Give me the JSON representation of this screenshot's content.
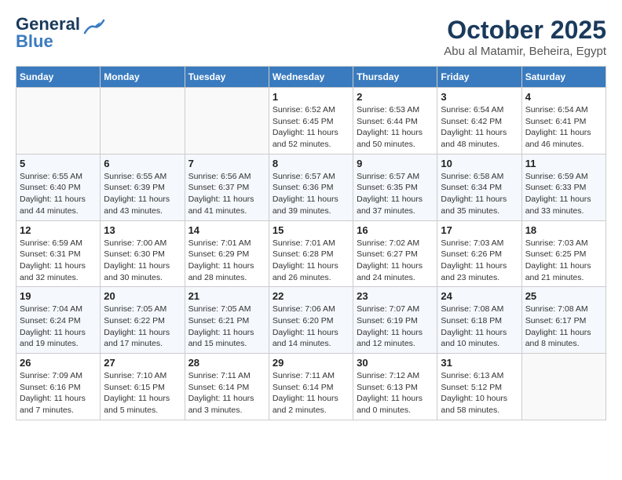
{
  "header": {
    "logo_line1": "General",
    "logo_line2": "Blue",
    "month": "October 2025",
    "location": "Abu al Matamir, Beheira, Egypt"
  },
  "weekdays": [
    "Sunday",
    "Monday",
    "Tuesday",
    "Wednesday",
    "Thursday",
    "Friday",
    "Saturday"
  ],
  "weeks": [
    [
      {
        "day": "",
        "info": ""
      },
      {
        "day": "",
        "info": ""
      },
      {
        "day": "",
        "info": ""
      },
      {
        "day": "1",
        "info": "Sunrise: 6:52 AM\nSunset: 6:45 PM\nDaylight: 11 hours\nand 52 minutes."
      },
      {
        "day": "2",
        "info": "Sunrise: 6:53 AM\nSunset: 6:44 PM\nDaylight: 11 hours\nand 50 minutes."
      },
      {
        "day": "3",
        "info": "Sunrise: 6:54 AM\nSunset: 6:42 PM\nDaylight: 11 hours\nand 48 minutes."
      },
      {
        "day": "4",
        "info": "Sunrise: 6:54 AM\nSunset: 6:41 PM\nDaylight: 11 hours\nand 46 minutes."
      }
    ],
    [
      {
        "day": "5",
        "info": "Sunrise: 6:55 AM\nSunset: 6:40 PM\nDaylight: 11 hours\nand 44 minutes."
      },
      {
        "day": "6",
        "info": "Sunrise: 6:55 AM\nSunset: 6:39 PM\nDaylight: 11 hours\nand 43 minutes."
      },
      {
        "day": "7",
        "info": "Sunrise: 6:56 AM\nSunset: 6:37 PM\nDaylight: 11 hours\nand 41 minutes."
      },
      {
        "day": "8",
        "info": "Sunrise: 6:57 AM\nSunset: 6:36 PM\nDaylight: 11 hours\nand 39 minutes."
      },
      {
        "day": "9",
        "info": "Sunrise: 6:57 AM\nSunset: 6:35 PM\nDaylight: 11 hours\nand 37 minutes."
      },
      {
        "day": "10",
        "info": "Sunrise: 6:58 AM\nSunset: 6:34 PM\nDaylight: 11 hours\nand 35 minutes."
      },
      {
        "day": "11",
        "info": "Sunrise: 6:59 AM\nSunset: 6:33 PM\nDaylight: 11 hours\nand 33 minutes."
      }
    ],
    [
      {
        "day": "12",
        "info": "Sunrise: 6:59 AM\nSunset: 6:31 PM\nDaylight: 11 hours\nand 32 minutes."
      },
      {
        "day": "13",
        "info": "Sunrise: 7:00 AM\nSunset: 6:30 PM\nDaylight: 11 hours\nand 30 minutes."
      },
      {
        "day": "14",
        "info": "Sunrise: 7:01 AM\nSunset: 6:29 PM\nDaylight: 11 hours\nand 28 minutes."
      },
      {
        "day": "15",
        "info": "Sunrise: 7:01 AM\nSunset: 6:28 PM\nDaylight: 11 hours\nand 26 minutes."
      },
      {
        "day": "16",
        "info": "Sunrise: 7:02 AM\nSunset: 6:27 PM\nDaylight: 11 hours\nand 24 minutes."
      },
      {
        "day": "17",
        "info": "Sunrise: 7:03 AM\nSunset: 6:26 PM\nDaylight: 11 hours\nand 23 minutes."
      },
      {
        "day": "18",
        "info": "Sunrise: 7:03 AM\nSunset: 6:25 PM\nDaylight: 11 hours\nand 21 minutes."
      }
    ],
    [
      {
        "day": "19",
        "info": "Sunrise: 7:04 AM\nSunset: 6:24 PM\nDaylight: 11 hours\nand 19 minutes."
      },
      {
        "day": "20",
        "info": "Sunrise: 7:05 AM\nSunset: 6:22 PM\nDaylight: 11 hours\nand 17 minutes."
      },
      {
        "day": "21",
        "info": "Sunrise: 7:05 AM\nSunset: 6:21 PM\nDaylight: 11 hours\nand 15 minutes."
      },
      {
        "day": "22",
        "info": "Sunrise: 7:06 AM\nSunset: 6:20 PM\nDaylight: 11 hours\nand 14 minutes."
      },
      {
        "day": "23",
        "info": "Sunrise: 7:07 AM\nSunset: 6:19 PM\nDaylight: 11 hours\nand 12 minutes."
      },
      {
        "day": "24",
        "info": "Sunrise: 7:08 AM\nSunset: 6:18 PM\nDaylight: 11 hours\nand 10 minutes."
      },
      {
        "day": "25",
        "info": "Sunrise: 7:08 AM\nSunset: 6:17 PM\nDaylight: 11 hours\nand 8 minutes."
      }
    ],
    [
      {
        "day": "26",
        "info": "Sunrise: 7:09 AM\nSunset: 6:16 PM\nDaylight: 11 hours\nand 7 minutes."
      },
      {
        "day": "27",
        "info": "Sunrise: 7:10 AM\nSunset: 6:15 PM\nDaylight: 11 hours\nand 5 minutes."
      },
      {
        "day": "28",
        "info": "Sunrise: 7:11 AM\nSunset: 6:14 PM\nDaylight: 11 hours\nand 3 minutes."
      },
      {
        "day": "29",
        "info": "Sunrise: 7:11 AM\nSunset: 6:14 PM\nDaylight: 11 hours\nand 2 minutes."
      },
      {
        "day": "30",
        "info": "Sunrise: 7:12 AM\nSunset: 6:13 PM\nDaylight: 11 hours\nand 0 minutes."
      },
      {
        "day": "31",
        "info": "Sunrise: 6:13 AM\nSunset: 5:12 PM\nDaylight: 10 hours\nand 58 minutes."
      },
      {
        "day": "",
        "info": ""
      }
    ]
  ]
}
